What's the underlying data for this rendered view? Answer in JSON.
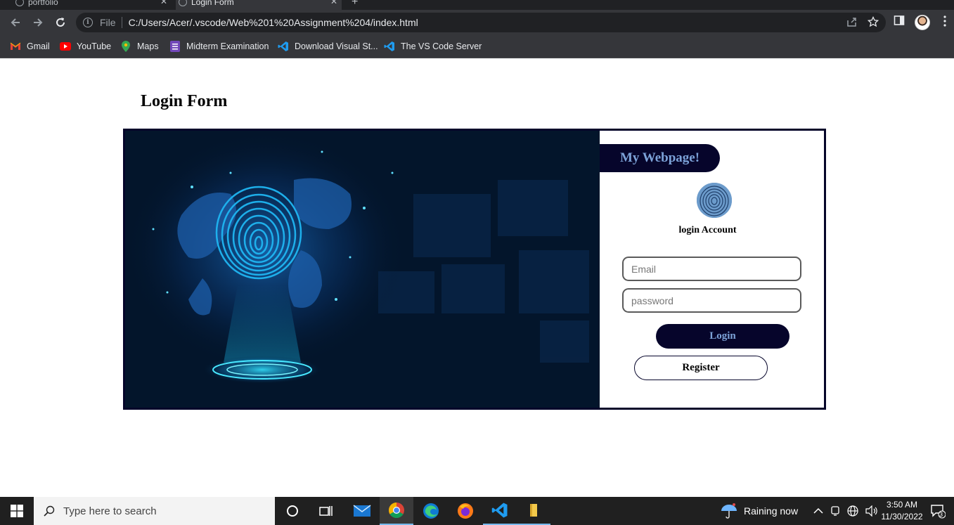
{
  "browser": {
    "tabs": [
      {
        "label": "portfolio",
        "active": false
      },
      {
        "label": "Login Form",
        "active": true
      }
    ],
    "omnibox": {
      "scheme_label": "File",
      "url": "C:/Users/Acer/.vscode/Web%201%20Assignment%204/index.html"
    },
    "bookmarks": [
      {
        "label": "Gmail",
        "icon": "gmail-icon"
      },
      {
        "label": "YouTube",
        "icon": "youtube-icon"
      },
      {
        "label": "Maps",
        "icon": "maps-icon"
      },
      {
        "label": "Midterm Examination",
        "icon": "forms-icon"
      },
      {
        "label": "Download Visual St...",
        "icon": "vscode-icon"
      },
      {
        "label": "The VS Code Server",
        "icon": "vscode-icon"
      }
    ]
  },
  "page": {
    "title": "Login Form",
    "brand": "My Webpage!",
    "account_heading": "login Account",
    "email_placeholder": "Email",
    "password_placeholder": "password",
    "login_label": "Login",
    "register_label": "Register",
    "colors": {
      "navy": "#06052b",
      "accent": "#7ca2d8",
      "hero_bg": "#03152b"
    }
  },
  "taskbar": {
    "search_placeholder": "Type here to search",
    "apps": [
      "task-view-icon",
      "mail-icon",
      "chrome-icon",
      "edge-icon",
      "firefox-icon",
      "vscode-icon",
      "file-explorer-icon"
    ],
    "weather": "Raining now",
    "time": "3:50 AM",
    "date": "11/30/2022",
    "notification_count": "3"
  }
}
